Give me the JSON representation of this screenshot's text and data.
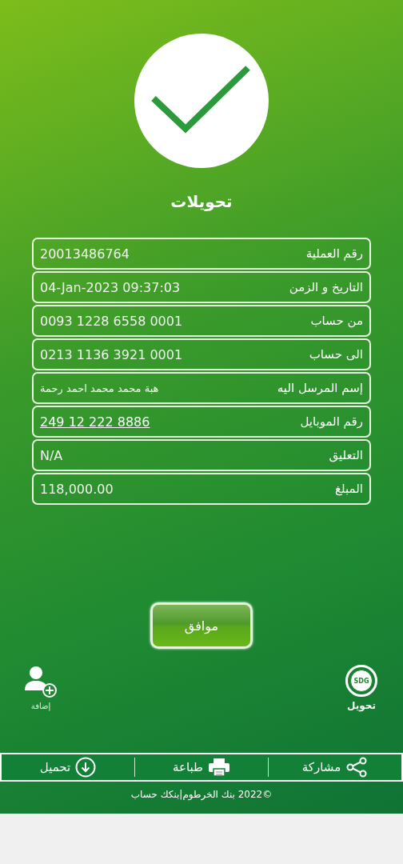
{
  "title": "تحويلات",
  "details": [
    {
      "label": "رقم العملية",
      "value": "20013486764",
      "kind": "text"
    },
    {
      "label": "التاريخ و الزمن",
      "value": "04-Jan-2023 09:37:03",
      "kind": "text"
    },
    {
      "label": "من حساب",
      "value": "0093 1228 6558 0001",
      "kind": "text"
    },
    {
      "label": "الى حساب",
      "value": "0213 1136 3921 0001",
      "kind": "text"
    },
    {
      "label": "إسم المرسل اليه",
      "value": "هبة محمد محمد احمد رحمة",
      "kind": "small"
    },
    {
      "label": "رقم الموبايل",
      "value": "249 12 222 8886",
      "kind": "link"
    },
    {
      "label": "التعليق",
      "value": "N/A",
      "kind": "text"
    },
    {
      "label": "المبلغ",
      "value": "118,000.00",
      "kind": "text"
    }
  ],
  "ok_button": "موافق",
  "add_shortcut": {
    "label": "إضافة"
  },
  "transfer_shortcut": {
    "badge": "SDG",
    "label": "تحويل"
  },
  "actions": [
    {
      "kind": "share",
      "label": "مشاركة"
    },
    {
      "kind": "print",
      "label": "طباعة"
    },
    {
      "kind": "download",
      "label": "تحميل"
    }
  ],
  "footer": "©2022 بنك الخرطوم|بنكك حساب"
}
